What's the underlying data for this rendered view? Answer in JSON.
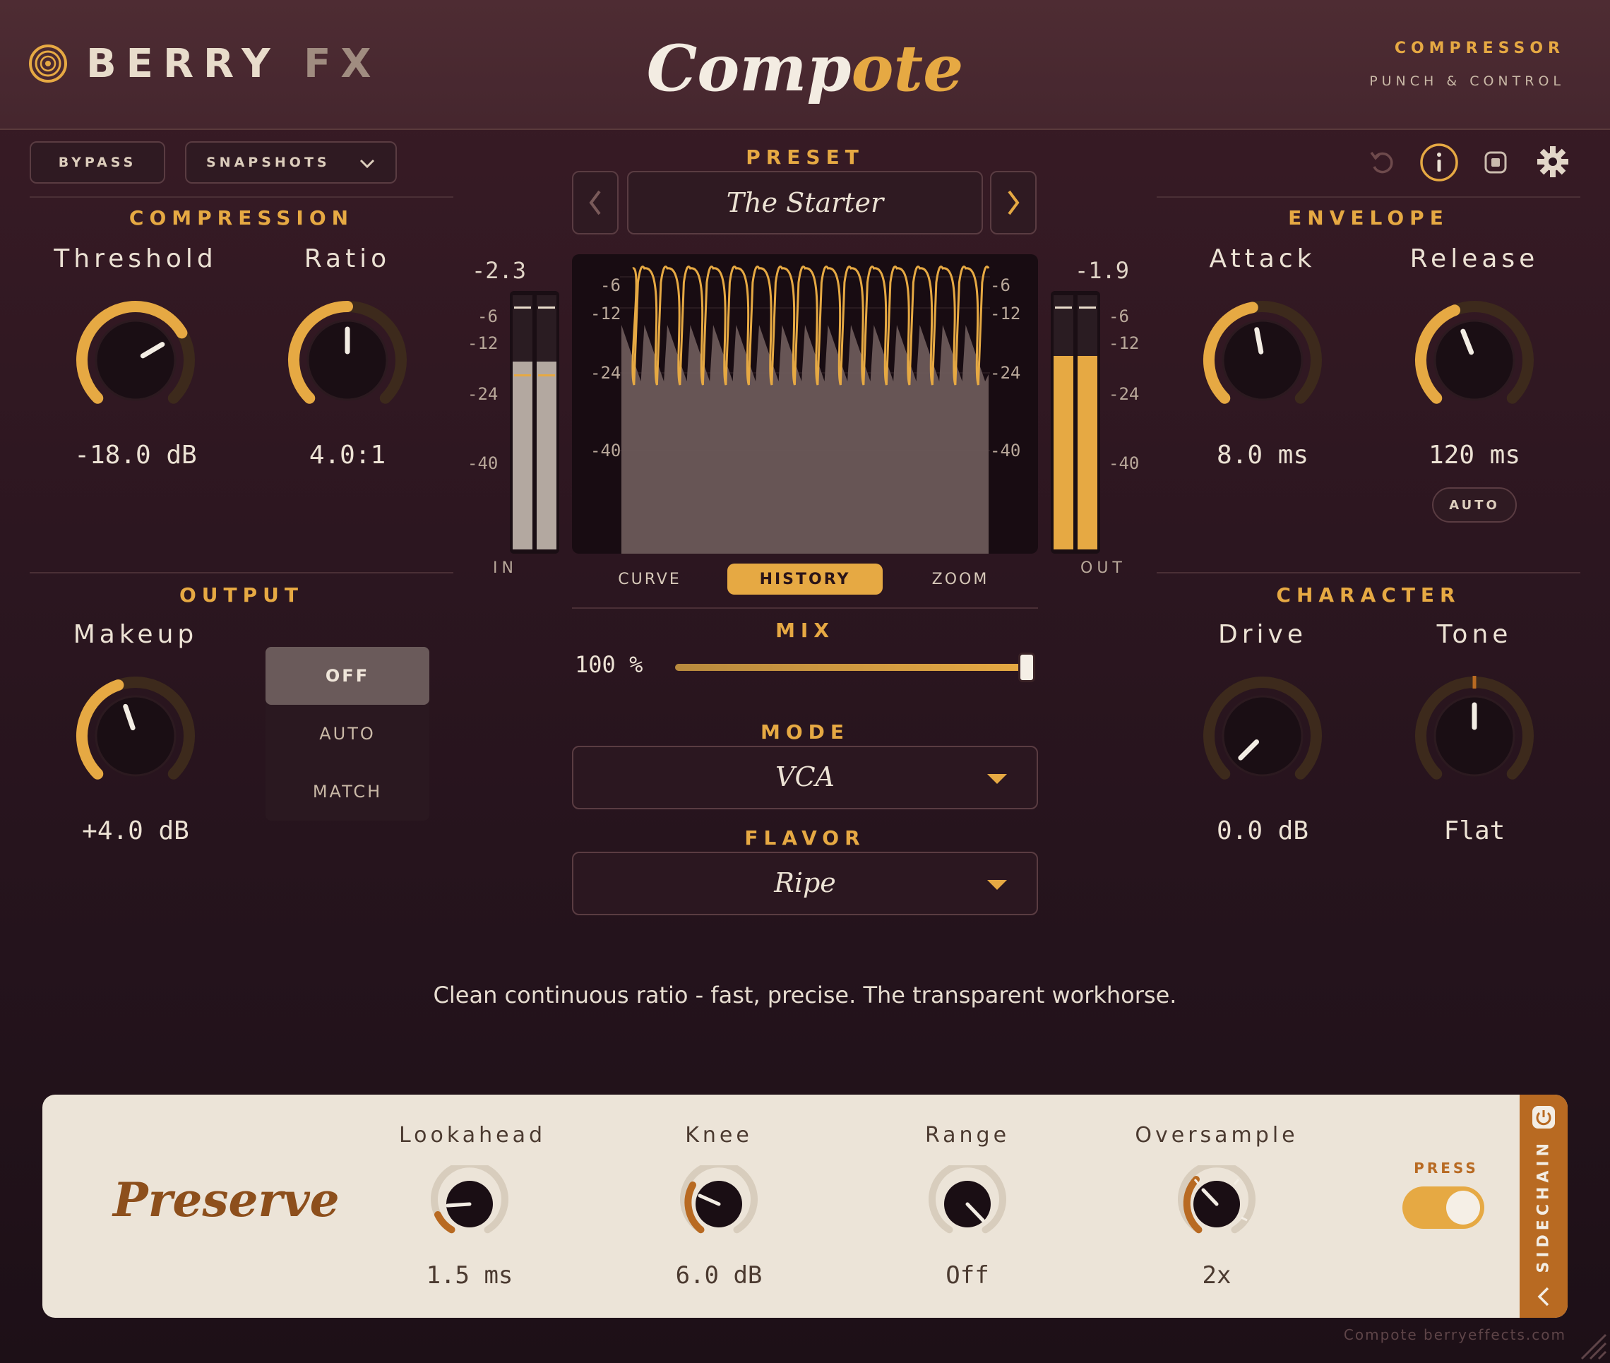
{
  "header": {
    "brand_main": "BERRY",
    "brand_accent": "FX",
    "title_main": "Comp",
    "title_accent": "ote",
    "category": "COMPRESSOR",
    "tagline": "PUNCH & CONTROL"
  },
  "toolbar": {
    "bypass_label": "BYPASS",
    "snapshots_label": "SNAPSHOTS",
    "icons": [
      "undo-icon",
      "info-icon",
      "record-icon",
      "gear-icon"
    ]
  },
  "compression": {
    "title": "COMPRESSION",
    "threshold": {
      "label": "Threshold",
      "value": "-18.0 dB",
      "level": 0.72
    },
    "ratio": {
      "label": "Ratio",
      "value": "4.0:1",
      "level": 0.5
    }
  },
  "output": {
    "title": "OUTPUT",
    "makeup": {
      "label": "Makeup",
      "value": "+4.0 dB",
      "level": 0.43
    },
    "modes": [
      "OFF",
      "AUTO",
      "MATCH"
    ],
    "selected_mode": "OFF"
  },
  "preset": {
    "title": "PRESET",
    "name": "The Starter"
  },
  "meters": {
    "in_label": "IN",
    "out_label": "OUT",
    "in_value": "-2.3",
    "out_value": "-1.9",
    "scale": [
      "-6",
      "-12",
      "-24",
      "-40"
    ],
    "in_level": 0.74,
    "out_level": 0.76
  },
  "display": {
    "tabs": [
      "CURVE",
      "HISTORY",
      "ZOOM"
    ],
    "active_tab": "HISTORY",
    "scale": [
      "-6",
      "-12",
      "-24",
      "-40"
    ]
  },
  "mix": {
    "title": "MIX",
    "value": "100 %",
    "level": 1.0
  },
  "mode": {
    "title": "MODE",
    "value": "VCA"
  },
  "flavor": {
    "title": "FLAVOR",
    "value": "Ripe"
  },
  "envelope": {
    "title": "ENVELOPE",
    "attack": {
      "label": "Attack",
      "value": "8.0 ms",
      "level": 0.46
    },
    "release": {
      "label": "Release",
      "value": "120 ms",
      "level": 0.42
    },
    "auto_label": "AUTO"
  },
  "character": {
    "title": "CHARACTER",
    "drive": {
      "label": "Drive",
      "value": "0.0 dB",
      "level": 0.0
    },
    "tone": {
      "label": "Tone",
      "value": "Flat",
      "level": 0.5
    }
  },
  "description": "Clean continuous ratio - fast, precise. The transparent workhorse.",
  "preserve": {
    "title": "Preserve",
    "lookahead": {
      "label": "Lookahead",
      "value": "1.5 ms"
    },
    "knee": {
      "label": "Knee",
      "value": "6.0 dB"
    },
    "range": {
      "label": "Range",
      "value": "Off"
    },
    "oversample": {
      "label": "Oversample",
      "value": "2x"
    },
    "press_label": "PRESS",
    "sidechain_label": "SIDECHAIN"
  },
  "footer": {
    "product": "Compote",
    "website": "berryeffects.com"
  },
  "colors": {
    "accent": "#e6a943",
    "background": "#2c1620",
    "panel": "#ece4d8",
    "sidechain": "#b86a22"
  }
}
